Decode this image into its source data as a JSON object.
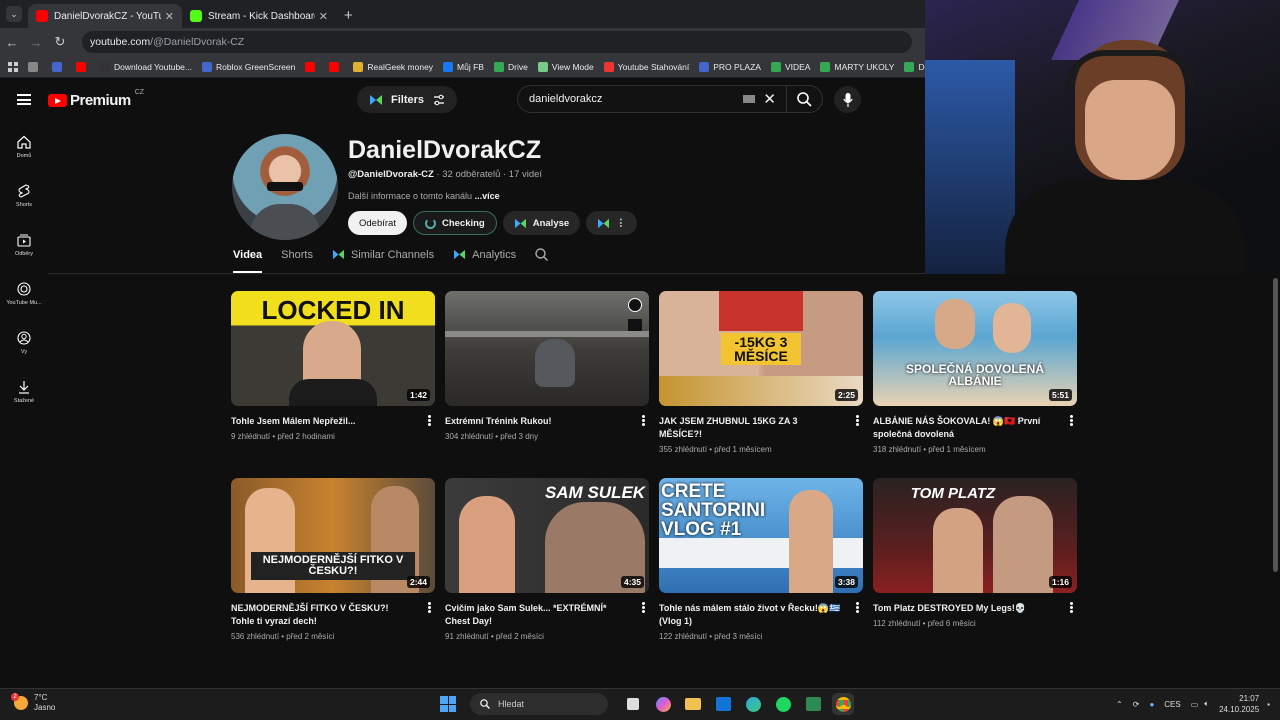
{
  "browser": {
    "tabs": [
      {
        "label": "DanielDvorakCZ - YouTube",
        "active": true,
        "color": "#ff0000"
      },
      {
        "label": "Stream - Kick Dashboard",
        "active": false,
        "color": "#53fc18"
      }
    ],
    "url_host": "youtube.com",
    "url_path": "/@DanielDvorak-CZ",
    "bookmarks": [
      {
        "label": "",
        "color": "#888"
      },
      {
        "label": "",
        "color": "#4466cc"
      },
      {
        "label": "",
        "color": "#ff0000"
      },
      {
        "label": "Download Youtube...",
        "color": "#333"
      },
      {
        "label": "Roblox GreenScreen",
        "color": "#4466cc"
      },
      {
        "label": "",
        "color": "#ff0000"
      },
      {
        "label": "",
        "color": "#ff0000"
      },
      {
        "label": "RealGeek money",
        "color": "#e0b030"
      },
      {
        "label": "Můj FB",
        "color": "#1877f2"
      },
      {
        "label": "Drive",
        "color": "#34a853"
      },
      {
        "label": "View Mode",
        "color": "#7c8"
      },
      {
        "label": "Youtube Stahování",
        "color": "#e33"
      },
      {
        "label": "PRO PLAZA",
        "color": "#4466cc"
      },
      {
        "label": "VIDEA",
        "color": "#34a853"
      },
      {
        "label": "MARTY UKOLY",
        "color": "#34a853"
      },
      {
        "label": "Dodo videa",
        "color": "#34a853"
      }
    ]
  },
  "header": {
    "logo_text": "Premium",
    "logo_country": "CZ",
    "filters_label": "Filters",
    "search_value": "danieldvorakcz"
  },
  "sidebar": {
    "items": [
      {
        "label": "Domů",
        "icon": "home-icon"
      },
      {
        "label": "Shorts",
        "icon": "shorts-icon"
      },
      {
        "label": "Odběry",
        "icon": "subscriptions-icon"
      },
      {
        "label": "YouTube Mu...",
        "icon": "music-icon"
      },
      {
        "label": "Vy",
        "icon": "you-icon"
      },
      {
        "label": "Stažené",
        "icon": "download-icon"
      }
    ]
  },
  "channel": {
    "name": "DanielDvorakCZ",
    "handle": "@DanielDvorak-CZ",
    "stats": " · 32 odběratelů · 17 videí",
    "desc": "Další informace o tomto kanálu ",
    "more": "...více",
    "subscribe": "Odebírat",
    "checking": "Checking",
    "analyse": "Analyse"
  },
  "nav": {
    "tabs": [
      "Videa",
      "Shorts",
      "Similar Channels",
      "Analytics"
    ]
  },
  "videos": [
    {
      "title": "Tohle Jsem Málem Nepřežil...",
      "meta": "9 zhlédnutí • před 2 hodinami",
      "duration": "1:42",
      "thumb_text": "LOCKED IN"
    },
    {
      "title": "Extrémní Trénink Rukou!",
      "meta": "304 zhlédnutí • před 3 dny",
      "duration": "",
      "thumb_text": ""
    },
    {
      "title": "JAK JSEM ZHUBNUL 15KG ZA 3 MĚSÍCE?!",
      "meta": "355 zhlédnutí • před 1 měsícem",
      "duration": "2:25",
      "thumb_text": "-15KG 3 MĚSÍCE"
    },
    {
      "title": "ALBÁNIE NÁS ŠOKOVALA! 😱🇦🇱 První společná dovolená",
      "meta": "318 zhlédnutí • před 1 měsícem",
      "duration": "5:51",
      "thumb_text": "SPOLEČNÁ DOVOLENÁ ALBÁNIE"
    },
    {
      "title": "NEJMODERNĚJŠÍ FITKO V ČESKU?! Tohle ti vyrazí dech!",
      "meta": "536 zhlédnutí • před 2 měsíci",
      "duration": "2:44",
      "thumb_text": "NEJMODERNĚJŠÍ FITKO V ČESKU?!"
    },
    {
      "title": "Cvičím jako Sam Sulek... *EXTRÉMNÍ* Chest Day!",
      "meta": "91 zhlédnutí • před 2 měsíci",
      "duration": "4:35",
      "thumb_text": "SAM SULEK"
    },
    {
      "title": "Tohle nás málem stálo život v Řecku!😱🇬🇷 (Vlog 1)",
      "meta": "122 zhlédnutí • před 3 měsíci",
      "duration": "3:38",
      "thumb_text": "CRETE SANTORINI VLOG #1"
    },
    {
      "title": "Tom Platz DESTROYED My Legs!💀",
      "meta": "112 zhlédnutí • před 6 měsíci",
      "duration": "1:16",
      "thumb_text": "TOM PLATZ"
    }
  ],
  "taskbar": {
    "temp": "7°C",
    "weather": "Jasno",
    "weather_badge": "2",
    "search": "Hledat",
    "lang": "CES",
    "time": "21:07",
    "date": "24.10.2025"
  }
}
